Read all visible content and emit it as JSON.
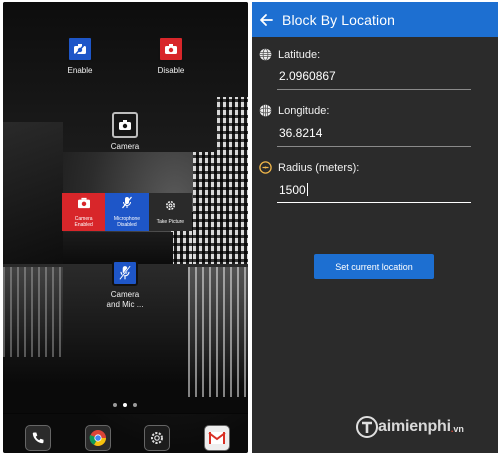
{
  "left_screen": {
    "apps": [
      {
        "label": "Enable",
        "icon": "camera-disabled-icon"
      },
      {
        "label": "Disable",
        "icon": "camera-enable-icon"
      },
      {
        "label": "Camera",
        "icon": "camera-icon"
      },
      {
        "label": "Camera\nand Mic ...",
        "icon": "microphone-disabled-icon"
      }
    ],
    "widget": [
      {
        "label": "Camera\nEnabled",
        "icon": "camera-icon",
        "color": "#d8262a"
      },
      {
        "label": "Microphone\nDisabled",
        "icon": "microphone-disabled-icon",
        "color": "#1e56c8"
      },
      {
        "label": "Take Picture",
        "icon": "gear-icon",
        "color": "#2a2a2a"
      }
    ],
    "page_indicator": {
      "pages": 3,
      "current": 2
    },
    "dock": [
      "phone-icon",
      "chrome-icon",
      "settings-icon",
      "gmail-icon"
    ]
  },
  "right_screen": {
    "title": "Block By Location",
    "accent": "#1d6fd1",
    "fields": [
      {
        "label": "Latitude:",
        "value": "2.0960867",
        "icon": "globe-icon"
      },
      {
        "label": "Longitude:",
        "value": "36.8214",
        "icon": "globe-icon"
      },
      {
        "label": "Radius (meters):",
        "value": "1500",
        "icon": "radius-icon"
      }
    ],
    "button_label": "Set current location"
  },
  "watermark": {
    "brand": "aimienphi",
    "dot": ".",
    "tld": "vn"
  }
}
